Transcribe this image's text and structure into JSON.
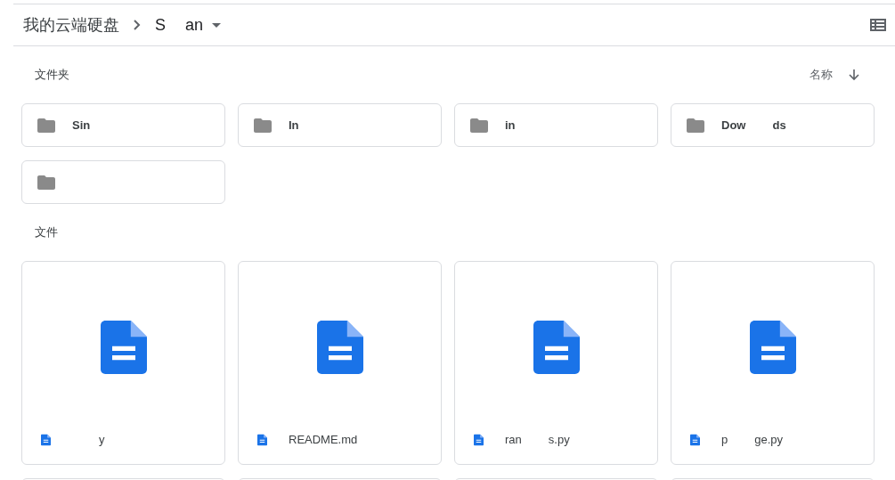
{
  "breadcrumb": [
    {
      "label": "我的云端硬盘",
      "kind": "root"
    },
    {
      "label_start": "S",
      "label_end": "an",
      "kind": "current"
    }
  ],
  "folders_section": {
    "title": "文件夹",
    "sort_label": "名称"
  },
  "folders": [
    {
      "kind": "folder",
      "name": "Sin"
    },
    {
      "kind": "folder",
      "name": "In"
    },
    {
      "kind": "folder",
      "name": "in"
    },
    {
      "kind": "folder",
      "name": "Dow",
      "name_end": "ds"
    },
    {
      "kind": "folder"
    }
  ],
  "files_section": {
    "title": "文件"
  },
  "files": [
    {
      "name_end": "y"
    },
    {
      "name": "README.md"
    },
    {
      "name": "ran",
      "name_end": "s.py"
    },
    {
      "name": "p",
      "name_end": "ge.py"
    }
  ]
}
